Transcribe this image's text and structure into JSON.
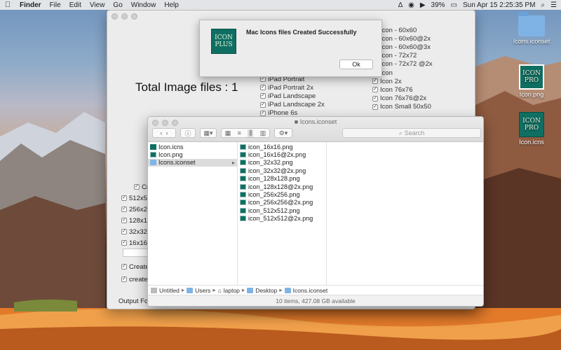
{
  "menubar": {
    "app": "Finder",
    "items": [
      "File",
      "Edit",
      "View",
      "Go",
      "Window",
      "Help"
    ],
    "battery": "39%",
    "clock": "Sun Apr 15  2:25:35 PM"
  },
  "desktop_icons": [
    {
      "label": "Icons.iconset",
      "icon": "folder-icon"
    },
    {
      "label": "Icon.png",
      "icon": "app-icon",
      "text": [
        "ICON",
        "PRO"
      ]
    },
    {
      "label": "Icon.icns",
      "icon": "app-icon",
      "text": [
        "ICON",
        "PRO"
      ]
    }
  ],
  "main_window": {
    "total": "Total Image files : 1",
    "mac_list": [
      "iPad Portrait",
      "iPad Portrait 2x",
      "iPad Landscape",
      "iPad Landscape 2x",
      "iPhone 6s"
    ],
    "ios_list": [
      "Icon - 60x60",
      "Icon - 60x60@2x",
      "Icon - 60x60@3x",
      "Icon - 72x72",
      "Icon - 72x72 @2x",
      "Icon",
      "Icon 2x",
      "Icon 76x76",
      "Icon 76x76@2x",
      "Icon Small 50x50"
    ],
    "left_options": [
      "Cr",
      "512x5",
      "256x2",
      "128x12",
      "32x32",
      "16x16"
    ],
    "create_label": "Create",
    "create2_label": "create",
    "output_label": "Output Fol"
  },
  "alert": {
    "message": "Mac Icons files Created Successfully",
    "ok": "Ok",
    "logo": [
      "ICON",
      "PLUS"
    ]
  },
  "finder": {
    "title": "Icons.iconset",
    "search_placeholder": "Search",
    "col1": [
      "Icon.icns",
      "Icon.png",
      "Icons.iconset"
    ],
    "col2": [
      "icon_16x16.png",
      "icon_16x16@2x.png",
      "icon_32x32.png",
      "icon_32x32@2x.png",
      "icon_128x128.png",
      "icon_128x128@2x.png",
      "icon_256x256.png",
      "icon_256x256@2x.png",
      "icon_512x512.png",
      "icon_512x512@2x.png"
    ],
    "path": [
      "Untitled",
      "Users",
      "laptop",
      "Desktop",
      "Icons.iconset"
    ],
    "status": "10 items, 427.08 GB available"
  }
}
